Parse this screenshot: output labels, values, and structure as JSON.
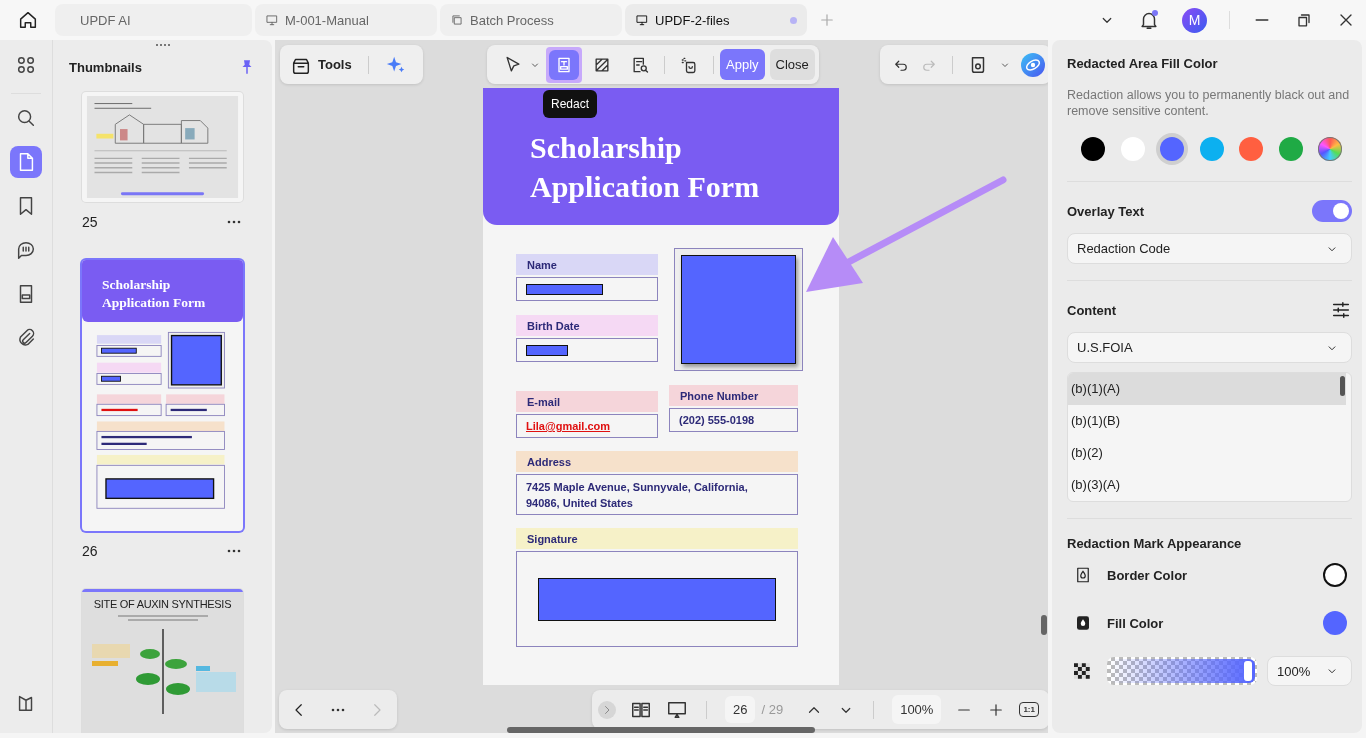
{
  "tabs": [
    {
      "label": "UPDF AI",
      "selected": false,
      "modified": false
    },
    {
      "label": "M-001-Manual",
      "selected": false,
      "modified": false
    },
    {
      "label": "Batch Process",
      "selected": false,
      "modified": false
    },
    {
      "label": "UPDF-2-files",
      "selected": true,
      "modified": true
    }
  ],
  "account": {
    "initial": "M",
    "notification": true
  },
  "rail": [
    {
      "selected": false
    },
    {
      "selected": false
    },
    {
      "selected": true
    },
    {
      "selected": false
    },
    {
      "selected": false
    },
    {
      "selected": false
    },
    {
      "selected": false
    }
  ],
  "thumbnails": {
    "title": "Thumbnails",
    "pages": [
      {
        "kind": "library",
        "number": "25",
        "selected": false
      },
      {
        "kind": "form",
        "number": "26",
        "selected": true,
        "title": "Scholarship Application Form"
      },
      {
        "kind": "auxin",
        "selected": false,
        "title": "SITE OF AUXIN SYNTHESIS"
      }
    ]
  },
  "toolbar": {
    "tools_label": "Tools",
    "redact_tools": [
      {
        "selected": false
      },
      {
        "selected": true
      },
      {
        "selected": false
      },
      {
        "selected": false
      },
      {
        "selected": false
      }
    ],
    "apply": "Apply",
    "close": "Close",
    "tooltip": "Redact"
  },
  "page": {
    "form": {
      "title": "Scholarship Application Form",
      "name_label": "Name",
      "birth_label": "Birth Date",
      "email_label": "E-mail",
      "email": "Lila@gmail.com",
      "phone_label": "Phone Number",
      "phone": "(202) 555-0198",
      "address_label": "Address",
      "address": "7425 Maple Avenue, Sunnyvale, California, 94086, United States",
      "signature_label": "Signature"
    }
  },
  "panel": {
    "fill_title": "Redacted Area Fill Color",
    "fill_description": "Redaction allows you to permanently black out and remove sensitive content.",
    "fill_colors": [
      {
        "kind": "solid",
        "color": "#000000",
        "selected": false
      },
      {
        "kind": "solid",
        "color": "#ffffff",
        "selected": false
      },
      {
        "kind": "solid",
        "color": "#5465ff",
        "selected": true
      },
      {
        "kind": "solid",
        "color": "#0cb0f0",
        "selected": false
      },
      {
        "kind": "solid",
        "color": "#ff5f40",
        "selected": false
      },
      {
        "kind": "solid",
        "color": "#1faa45",
        "selected": false
      },
      {
        "kind": "spectrum",
        "selected": false
      }
    ],
    "overlay": {
      "label": "Overlay Text",
      "on": true,
      "mode": "Redaction Code"
    },
    "content": {
      "label": "Content",
      "source": "U.S.FOIA",
      "codes": [
        {
          "label": "(b)(1)(A)",
          "selected": true
        },
        {
          "label": "(b)(1)(B)",
          "selected": false
        },
        {
          "label": "(b)(2)",
          "selected": false
        },
        {
          "label": "(b)(3)(A)",
          "selected": false
        }
      ]
    },
    "appearance": {
      "title": "Redaction Mark Appearance",
      "border": {
        "label": "Border Color",
        "color": "#ffffff"
      },
      "fill": {
        "label": "Fill Color",
        "color": "#5465ff"
      },
      "opacity": {
        "level": 1,
        "value": "100%"
      }
    }
  },
  "footer": {
    "page": "26",
    "total": "/ 29",
    "zoom": "100%",
    "actual_size": "1:1"
  }
}
